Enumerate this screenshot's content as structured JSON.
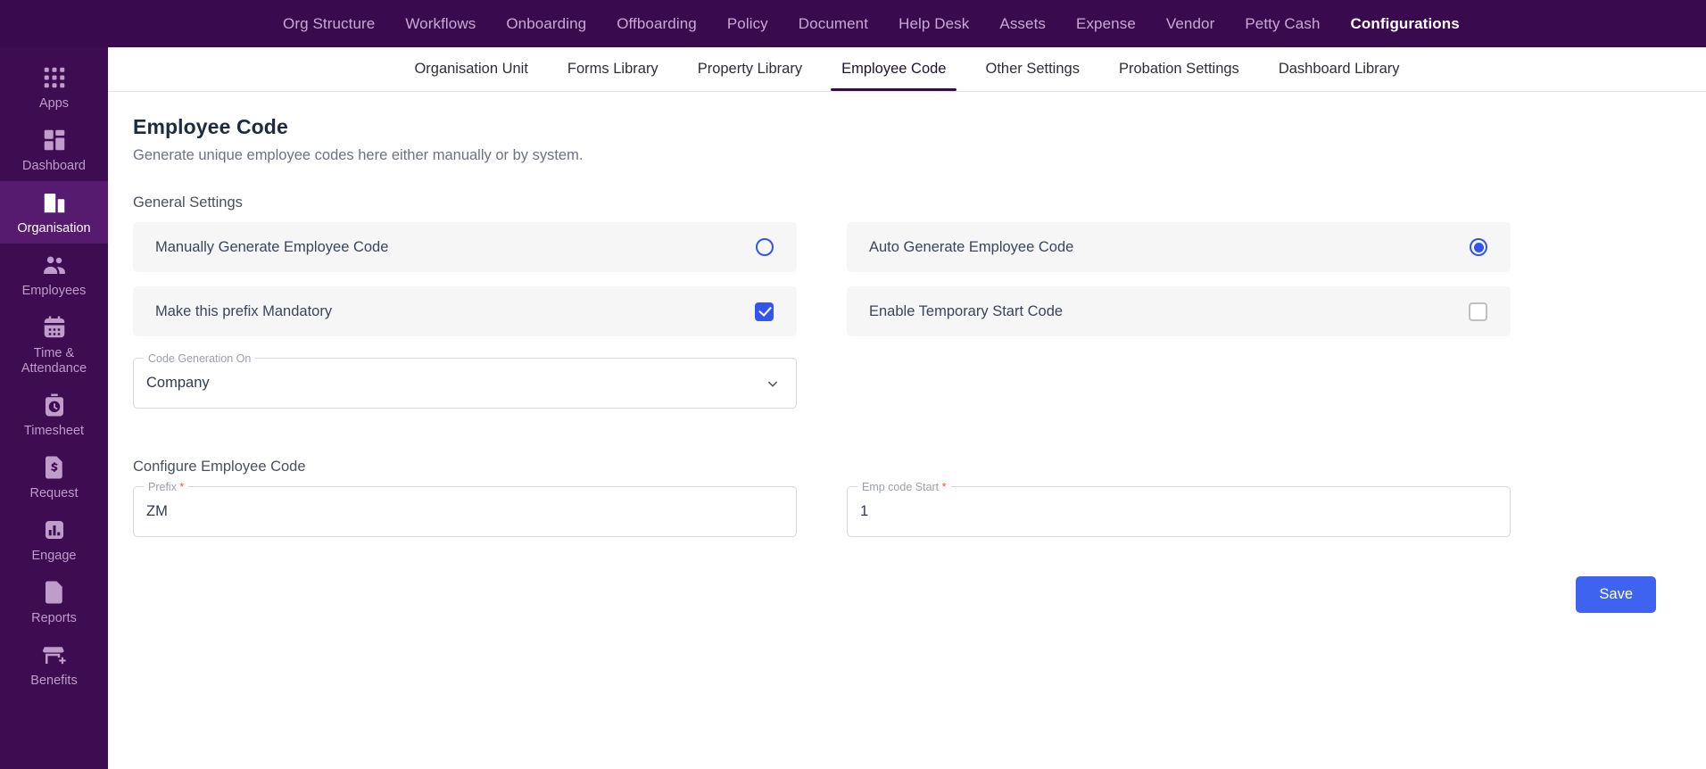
{
  "topnav": {
    "items": [
      {
        "label": "Org Structure",
        "active": false
      },
      {
        "label": "Workflows",
        "active": false
      },
      {
        "label": "Onboarding",
        "active": false
      },
      {
        "label": "Offboarding",
        "active": false
      },
      {
        "label": "Policy",
        "active": false
      },
      {
        "label": "Document",
        "active": false
      },
      {
        "label": "Help Desk",
        "active": false
      },
      {
        "label": "Assets",
        "active": false
      },
      {
        "label": "Expense",
        "active": false
      },
      {
        "label": "Vendor",
        "active": false
      },
      {
        "label": "Petty Cash",
        "active": false
      },
      {
        "label": "Configurations",
        "active": true
      }
    ]
  },
  "sidebar": {
    "items": [
      {
        "label": "Apps",
        "icon": "grid-apps-icon",
        "active": false
      },
      {
        "label": "Dashboard",
        "icon": "dashboard-icon",
        "active": false
      },
      {
        "label": "Organisation",
        "icon": "building-icon",
        "active": true
      },
      {
        "label": "Employees",
        "icon": "people-icon",
        "active": false
      },
      {
        "label": "Time & Attendance",
        "icon": "calendar-icon",
        "active": false
      },
      {
        "label": "Timesheet",
        "icon": "stopwatch-icon",
        "active": false
      },
      {
        "label": "Request",
        "icon": "dollar-document-icon",
        "active": false
      },
      {
        "label": "Engage",
        "icon": "bar-chart-icon",
        "active": false
      },
      {
        "label": "Reports",
        "icon": "report-document-icon",
        "active": false
      },
      {
        "label": "Benefits",
        "icon": "store-plus-icon",
        "active": false
      }
    ]
  },
  "subtabs": {
    "items": [
      {
        "label": "Organisation Unit",
        "active": false
      },
      {
        "label": "Forms Library",
        "active": false
      },
      {
        "label": "Property Library",
        "active": false
      },
      {
        "label": "Employee Code",
        "active": true
      },
      {
        "label": "Other Settings",
        "active": false
      },
      {
        "label": "Probation Settings",
        "active": false
      },
      {
        "label": "Dashboard Library",
        "active": false
      }
    ]
  },
  "page": {
    "title": "Employee Code",
    "subtitle": "Generate unique employee codes here either manually or by system.",
    "general_settings_label": "General Settings",
    "configure_label": "Configure Employee Code"
  },
  "general_settings": {
    "rows": [
      {
        "label": "Manually Generate Employee Code",
        "control": "radio",
        "checked": false
      },
      {
        "label": "Auto Generate Employee Code",
        "control": "radio",
        "checked": true
      },
      {
        "label": "Make this prefix Mandatory",
        "control": "checkbox",
        "checked": true
      },
      {
        "label": "Enable Temporary Start Code",
        "control": "checkbox",
        "checked": false
      }
    ],
    "code_generation_on": {
      "legend": "Code Generation On",
      "value": "Company",
      "required": false,
      "icon": "chevron-down-icon"
    }
  },
  "configure": {
    "prefix": {
      "legend": "Prefix",
      "value": "ZM",
      "required": true
    },
    "emp_code_start": {
      "legend": "Emp code Start",
      "value": "1",
      "required": true
    }
  },
  "footer": {
    "save_label": "Save"
  },
  "colors": {
    "brand_purple": "#3a0a4e",
    "sidebar_active": "#561a6e",
    "accent_blue": "#3355e8",
    "save_blue": "#3e63f0",
    "required_red": "#e2593f"
  }
}
